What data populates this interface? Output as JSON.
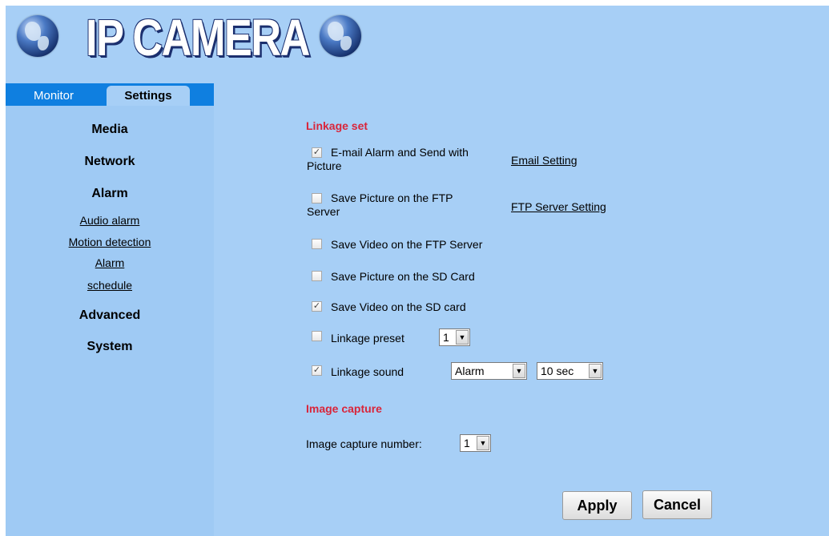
{
  "header": {
    "logo_title": "IP CAMERA",
    "left_icon": "globe-icon",
    "right_icon": "globe-icon"
  },
  "tabs": {
    "monitor": "Monitor",
    "settings": "Settings"
  },
  "sidebar": {
    "media": "Media",
    "network": "Network",
    "alarm": "Alarm",
    "audio_alarm": "Audio alarm",
    "motion_detection": "Motion detection",
    "alarm_schedule_1": "Alarm",
    "alarm_schedule_2": "schedule",
    "advanced": "Advanced",
    "system": "System"
  },
  "linkage": {
    "title": "Linkage set",
    "email": {
      "line1": "E-mail Alarm and Send with",
      "line2": "Picture",
      "checked": true,
      "link": "Email Setting"
    },
    "ftp_picture": {
      "line1": "Save Picture on the FTP",
      "line2": "Server",
      "checked": false,
      "link": "FTP Server Setting"
    },
    "ftp_video": {
      "label": "Save Video on the FTP Server",
      "checked": false
    },
    "sd_picture": {
      "label": "Save Picture on the SD Card",
      "checked": false
    },
    "sd_video": {
      "label": "Save Video on the SD card",
      "checked": true
    },
    "preset": {
      "label": "Linkage preset",
      "checked": false,
      "value": "1"
    },
    "sound": {
      "label": "Linkage sound",
      "checked": true,
      "sound_value": "Alarm",
      "duration_value": "10 sec"
    }
  },
  "capture": {
    "title": "Image capture",
    "number_label": "Image capture number:",
    "number_value": "1"
  },
  "buttons": {
    "apply": "Apply",
    "cancel": "Cancel"
  },
  "colors": {
    "background": "#a7cff6",
    "tab_bar": "#0f7fe0",
    "section_title": "#d9253a"
  }
}
